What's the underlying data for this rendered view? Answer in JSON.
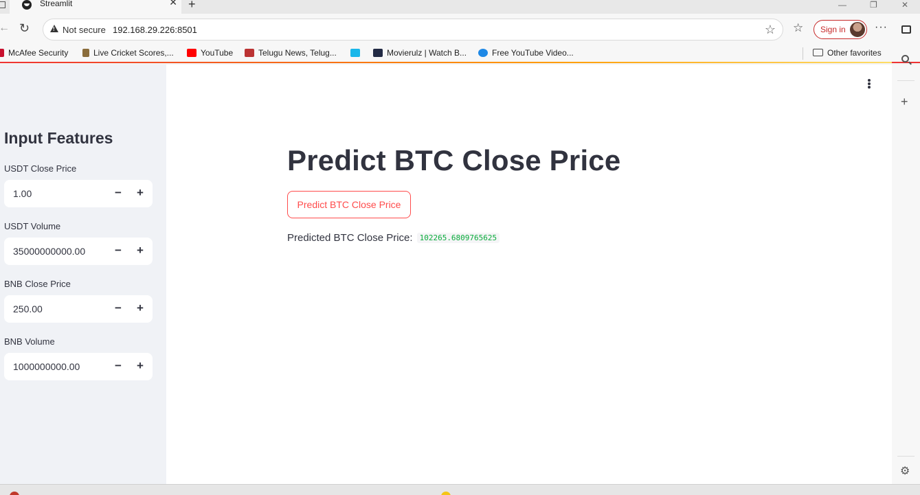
{
  "browser": {
    "tab_title": "Streamlit",
    "tab_close": "✕",
    "new_tab": "+",
    "window_controls": {
      "minimize": "—",
      "restore": "❐",
      "close": "✕"
    },
    "security_label": "Not secure",
    "url": "192.168.29.226:8501",
    "sign_in_label": "Sign in",
    "more": "···",
    "bookmarks": [
      {
        "label": "McAfee Security",
        "icon_color": "#c8102e"
      },
      {
        "label": "Live Cricket Scores,...",
        "icon_color": "#8a6d3b"
      },
      {
        "label": "YouTube",
        "icon_color": "#ff0000"
      },
      {
        "label": "Telugu News, Telug...",
        "icon_color": "#b33"
      },
      {
        "label": "",
        "icon_color": "#1ab7ea"
      },
      {
        "label": "Movierulz | Watch B...",
        "icon_color": "#222a44"
      },
      {
        "label": "Free YouTube Video...",
        "icon_color": "#1e88e5"
      }
    ],
    "other_favorites": "Other favorites"
  },
  "sidebar": {
    "heading": "Input Features",
    "fields": [
      {
        "label": "USDT Close Price",
        "value": "1.00"
      },
      {
        "label": "USDT Volume",
        "value": "35000000000.00"
      },
      {
        "label": "BNB Close Price",
        "value": "250.00"
      },
      {
        "label": "BNB Volume",
        "value": "1000000000.00"
      }
    ],
    "minus": "−",
    "plus": "+"
  },
  "main": {
    "title": "Predict BTC Close Price",
    "button_label": "Predict BTC Close Price",
    "result_label": "Predicted BTC Close Price:",
    "result_value": "102265.6809765625"
  },
  "colors": {
    "accent": "#ff4b4b",
    "result_text": "#09ab3b",
    "sidebar_bg": "#f0f2f6"
  }
}
